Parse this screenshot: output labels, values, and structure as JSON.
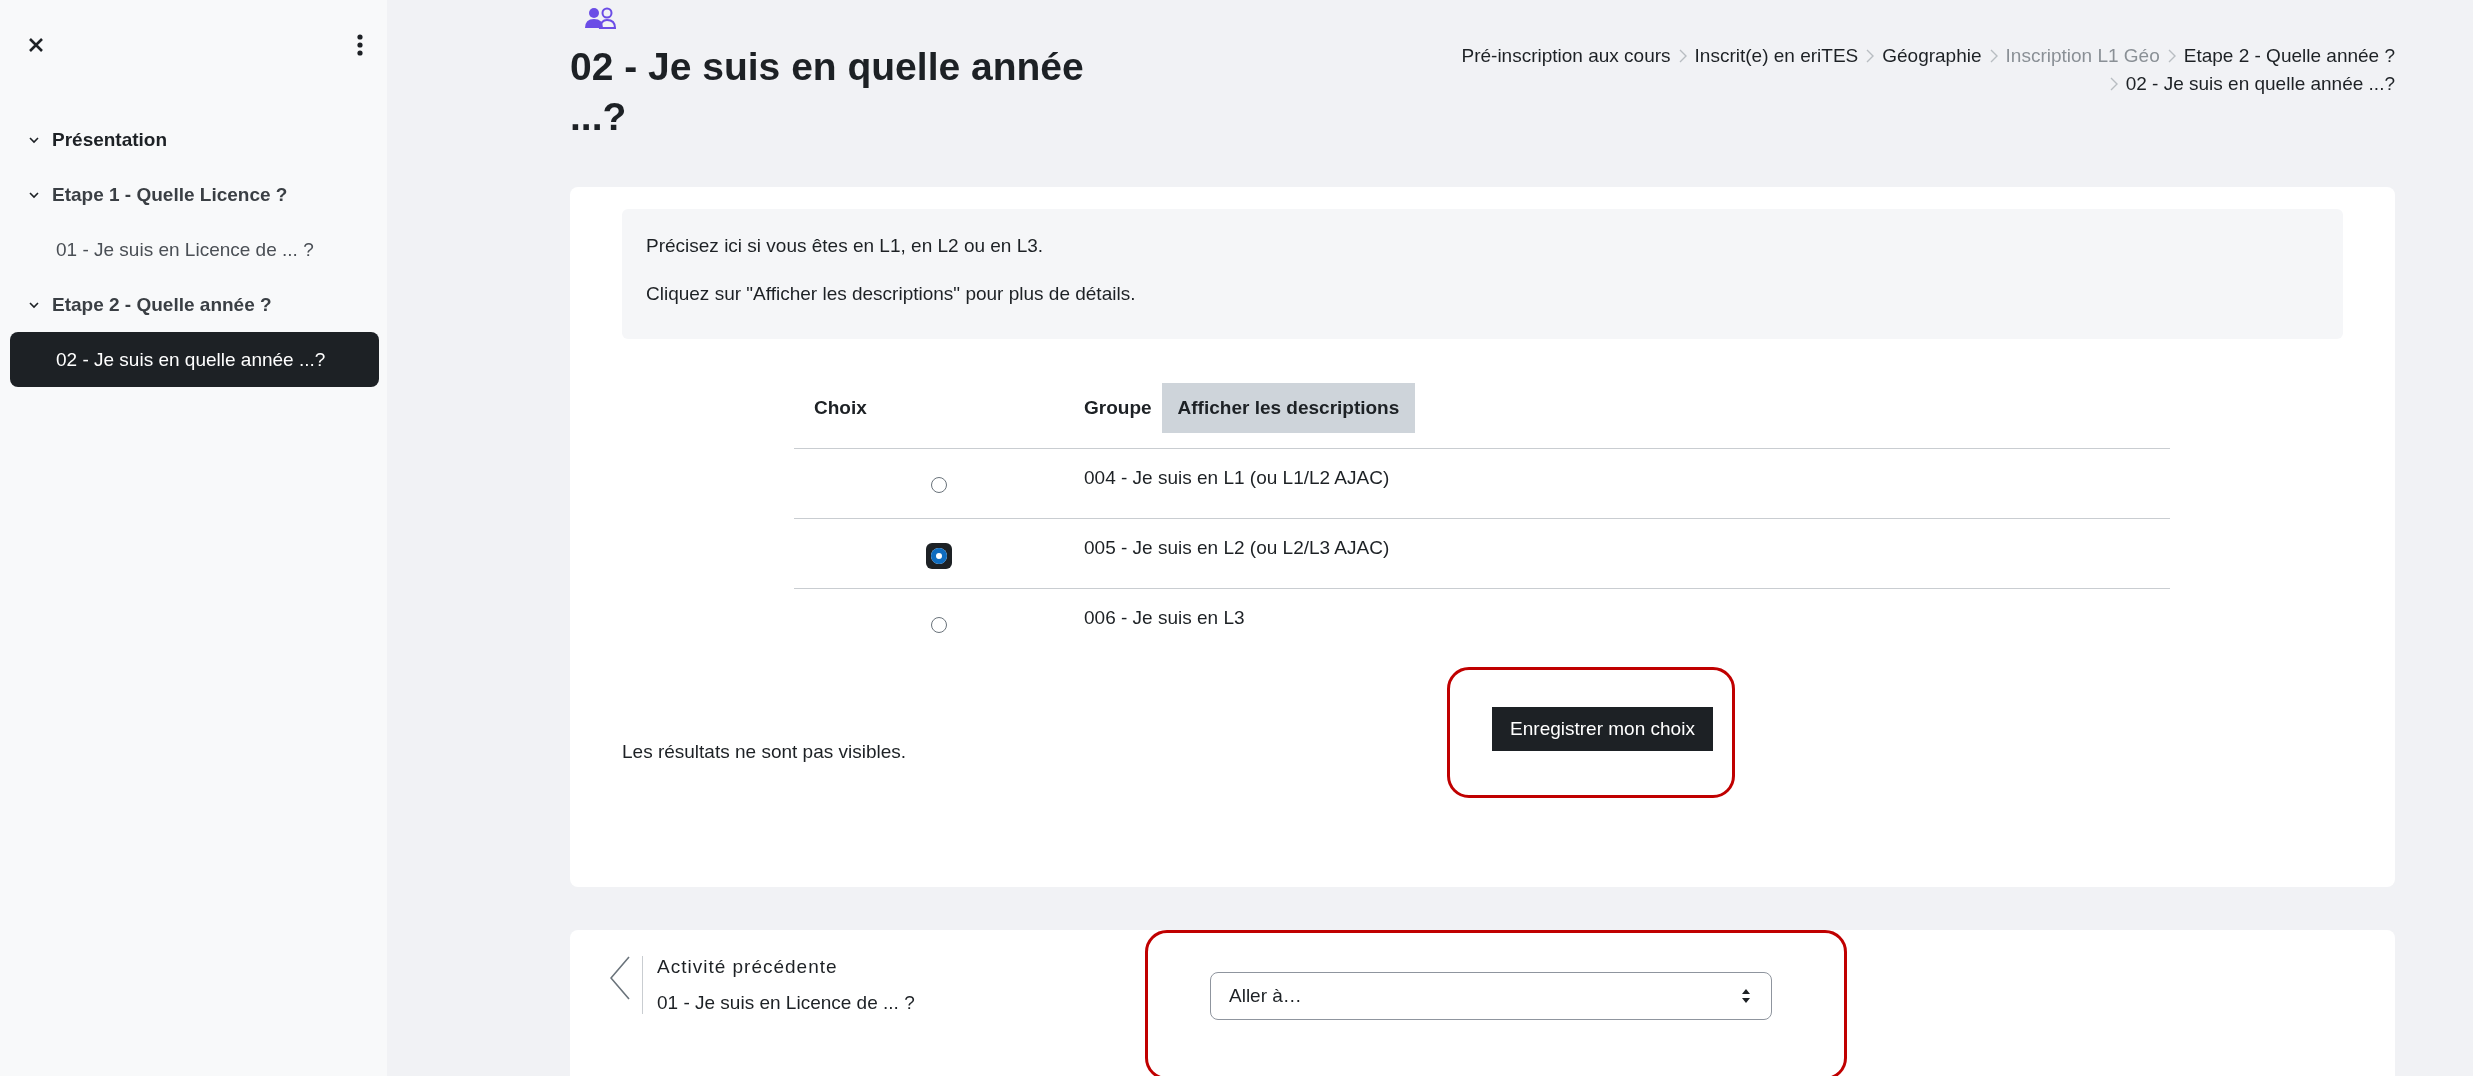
{
  "sidebar": {
    "course_index": [
      {
        "label": "Présentation",
        "expanded": true
      },
      {
        "label": "Etape 1 - Quelle Licence ?",
        "expanded": true,
        "children": [
          {
            "label": "01 - Je suis en Licence de ... ?",
            "selected": false
          }
        ]
      },
      {
        "label": "Etape 2 - Quelle année ?",
        "expanded": true,
        "children": [
          {
            "label": "02 - Je suis en quelle année ...?",
            "selected": true
          }
        ]
      }
    ]
  },
  "page_title": "02 - Je suis en quelle année ...?",
  "breadcrumb": [
    {
      "label": "Pré-inscription aux cours",
      "linked": true
    },
    {
      "label": "Inscrit(e) en eriTES",
      "linked": true
    },
    {
      "label": "Géographie",
      "linked": true
    },
    {
      "label": "Inscription L1 Géo",
      "linked": false
    },
    {
      "label": "Etape 2 - Quelle année ?",
      "linked": true
    },
    {
      "label": "02 - Je suis en quelle année ...?",
      "linked": true
    }
  ],
  "intro": [
    "Précisez ici si vous êtes en L1, en L2 ou en L3.",
    "Cliquez sur \"Afficher les descriptions\" pour plus de détails."
  ],
  "table": {
    "columns": [
      "Choix",
      "Groupe"
    ],
    "toggle_button": "Afficher les descriptions",
    "options": [
      {
        "label": "004 - Je suis en L1 (ou L1/L2 AJAC)",
        "selected": false
      },
      {
        "label": "005 - Je suis en L2 (ou L2/L3 AJAC)",
        "selected": true
      },
      {
        "label": "006 - Je suis en L3",
        "selected": false
      }
    ]
  },
  "save_button": {
    "label": "Enregistrer mon choix",
    "annotated": true
  },
  "results_note": "Les résultats ne sont pas visibles.",
  "activity_nav": {
    "previous_heading": "Activité précédente",
    "previous_title": "01 - Je suis en Licence de ... ?",
    "jump_select": {
      "value": "Aller à…",
      "annotated": true
    }
  }
}
